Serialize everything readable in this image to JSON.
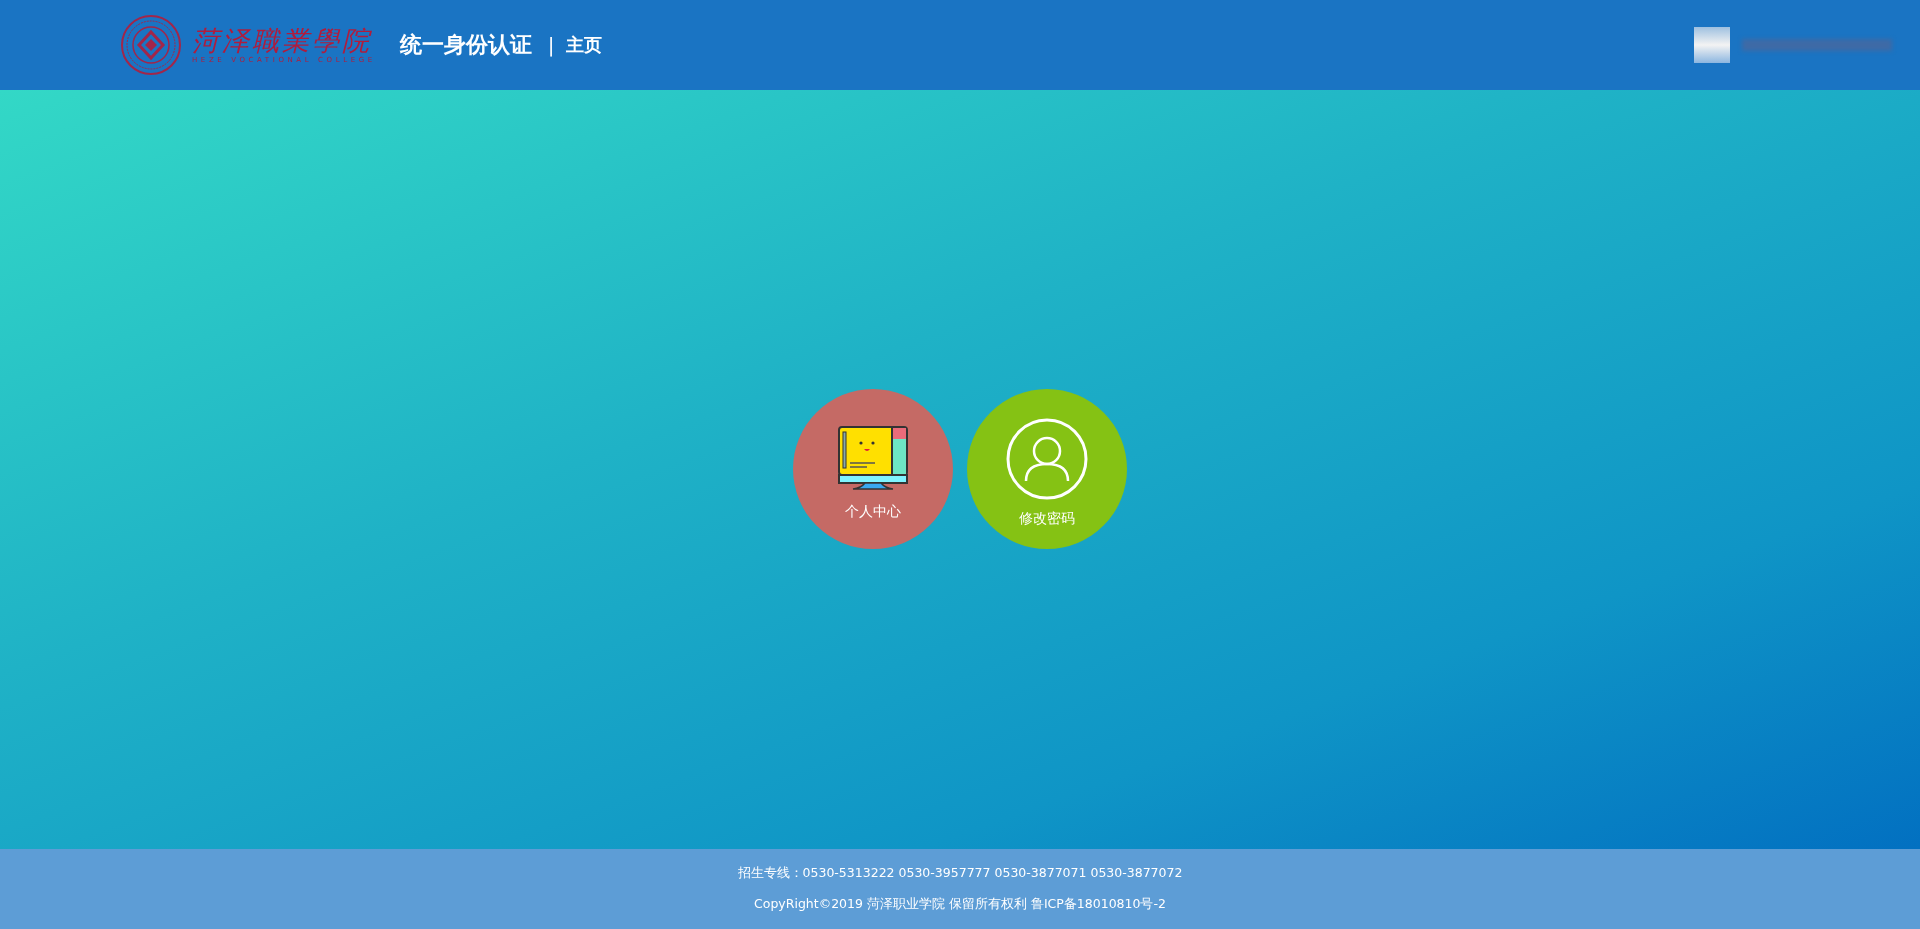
{
  "header": {
    "logo_name": "菏泽職業學院",
    "logo_subtitle": "HEZE VOCATIONAL COLLEGE",
    "title": "统一身份认证",
    "separator": "|",
    "page": "主页"
  },
  "tiles": [
    {
      "kind": "computer",
      "label": "个人中心",
      "color": "#c56a65"
    },
    {
      "kind": "user",
      "label": "修改密码",
      "color": "#85c214"
    }
  ],
  "footer": {
    "hotline": "招生专线：0530-5313222 0530-3957777 0530-3877071 0530-3877072",
    "copyright": "CopyRight©2019 菏泽职业学院 保留所有权利 鲁ICP备18010810号-2"
  }
}
